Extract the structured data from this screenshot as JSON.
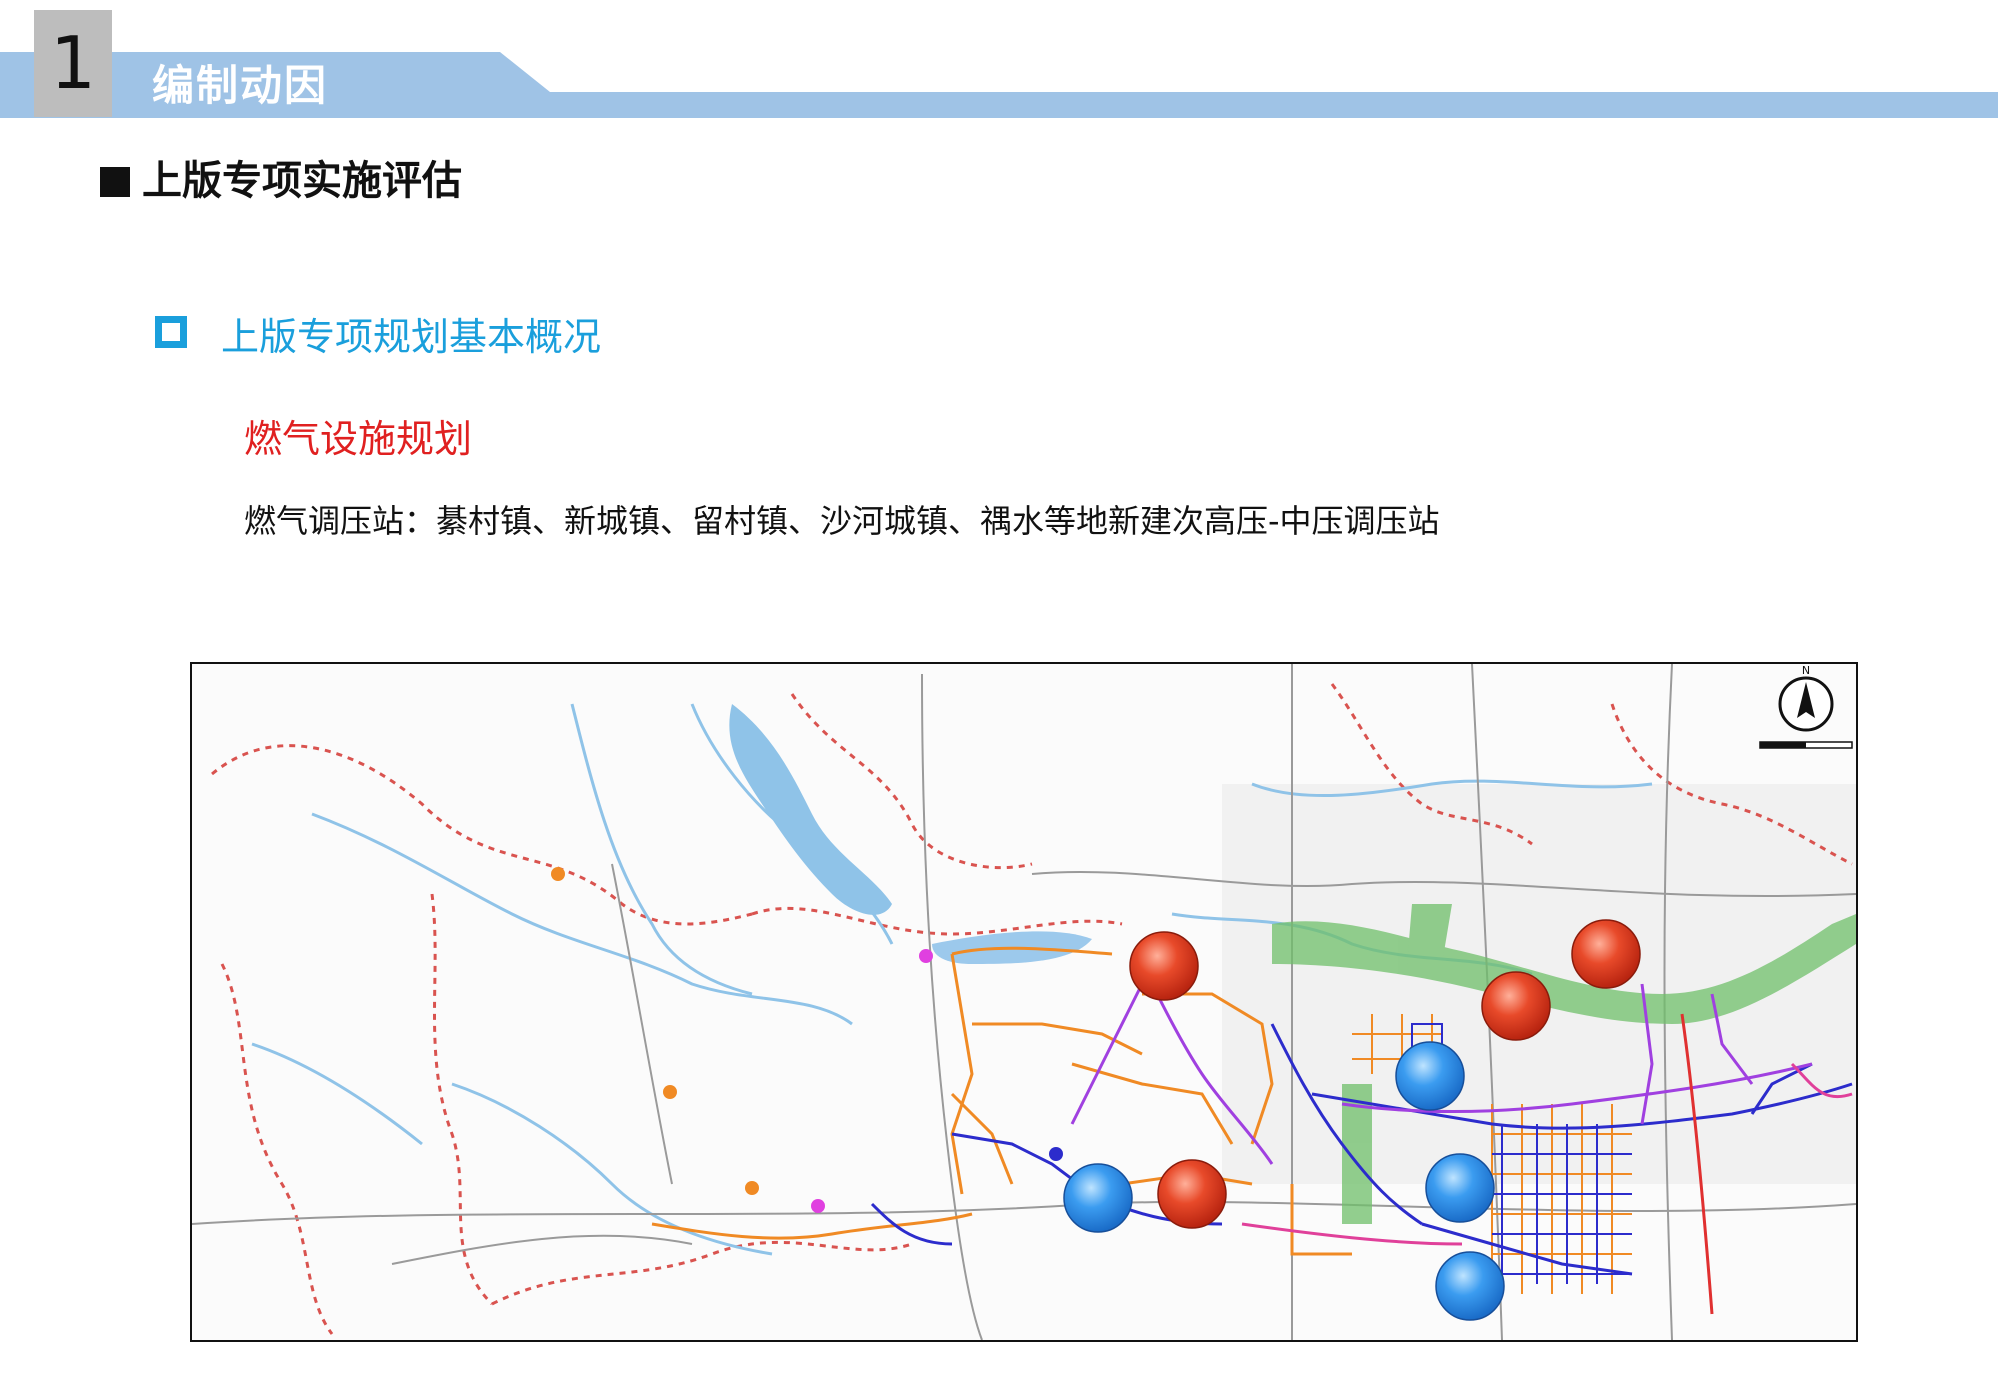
{
  "header": {
    "section_number": "1",
    "section_title": "编制动因",
    "band_color": "#9fc3e6"
  },
  "main_heading": "上版专项实施评估",
  "sub_heading": "上版专项规划基本概况",
  "red_heading": "燃气设施规划",
  "body_text": "燃气调压站：綦村镇、新城镇、留村镇、沙河城镇、禑水等地新建次高压-中压调压站",
  "colors": {
    "accent_blue": "#1a9fdc",
    "heading_red": "#e02020",
    "marker_red": "#e03a1e",
    "marker_blue": "#2f8fe6",
    "pipeline_orange": "#f08a24",
    "pipeline_blue": "#2c2ccc",
    "pipeline_purple": "#a040e0",
    "river_blue": "#8fc3e8",
    "green_zone": "#6fbf6a",
    "boundary_red": "#d9534f"
  },
  "map": {
    "north_arrow_icon": "north-arrow-icon",
    "markers": [
      {
        "type": "planned",
        "color": "red"
      },
      {
        "type": "planned",
        "color": "red"
      },
      {
        "type": "planned",
        "color": "red"
      },
      {
        "type": "planned",
        "color": "red"
      },
      {
        "type": "existing",
        "color": "blue"
      },
      {
        "type": "existing",
        "color": "blue"
      },
      {
        "type": "existing",
        "color": "blue"
      },
      {
        "type": "existing",
        "color": "blue"
      }
    ]
  }
}
